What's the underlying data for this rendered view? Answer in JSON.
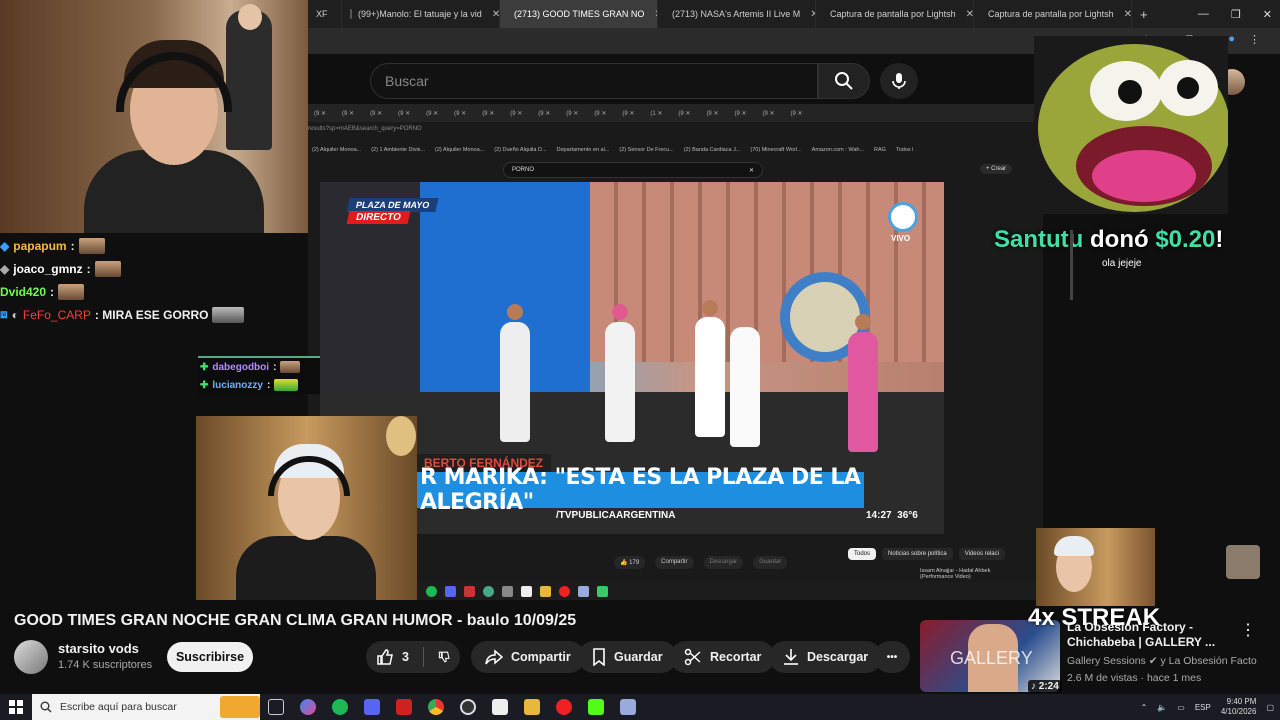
{
  "browser": {
    "tabs": [
      {
        "label": "XF",
        "active": false,
        "icon_color": "#444"
      },
      {
        "label": "(99+)Manolo: El tatuaje y la vid",
        "active": false,
        "icon_color": "#111"
      },
      {
        "label": "(2713) GOOD TIMES GRAN NO",
        "active": true,
        "icon_color": "#ff0033"
      },
      {
        "label": "(2713) NASA's Artemis II Live M",
        "active": false,
        "icon_color": "#ff0033"
      },
      {
        "label": "Captura de pantalla por Lightsh",
        "active": false,
        "icon_color": "#9a4ee0"
      },
      {
        "label": "Captura de pantalla por Lightsh",
        "active": false,
        "icon_color": "#9a4ee0"
      }
    ],
    "new_tab": "+"
  },
  "youtube": {
    "search_placeholder": "Buscar",
    "video_title": "GOOD TIMES GRAN NOCHE GRAN CLIMA GRAN HUMOR - baulo 10/09/25",
    "channel_name": "starsito vods",
    "subscribers": "1.74 K suscriptores",
    "subscribe_label": "Suscribirse",
    "like_count": "3",
    "share_label": "Compartir",
    "save_label": "Guardar",
    "clip_label": "Recortar",
    "download_label": "Descargar",
    "more_label": "•••",
    "recommended": {
      "title": "La Obsesión Factory - Chichabeba | GALLERY ...",
      "channel": "Gallery Sessions",
      "channel_extra": "y La Obsesión Facto...",
      "meta": "2.6 M de vistas · hace 1 mes",
      "duration": "2:24",
      "thumb_text": "GALLERY"
    }
  },
  "nested": {
    "url": "results?sp=mAEB&search_query=PORNO",
    "search_value": "PORNO",
    "create_label": "+ Crear",
    "bookmarks": [
      "(2) Alquiler Monoa...",
      "(2) 1 Ambiente Divis...",
      "(2) Alquiler Monoa...",
      "(2) Dueño Alquila D...",
      "Departamento en al...",
      "(2) Sensor De Frecu...",
      "(2) Banda Cardiaca J...",
      "(70) Minecraft Worl...",
      "Amazon.com : Wah...",
      "RAG",
      "Todos l"
    ],
    "like_count": "179",
    "actions": [
      "Compartir",
      "Descargar",
      "Guardar"
    ],
    "chips": [
      "Todos",
      "Noticias sobre política",
      "Videos relaci"
    ],
    "rec_title": "Issam Alnajjar - Hadal Ahbek (Performance Video)",
    "video": {
      "plaza_label": "PLAZA DE MAYO",
      "directo_label": "DIRECTO",
      "vivo_label": "VIVO",
      "chyron_name": "BERTO FERNÁNDEZ",
      "chyron_main": "R MARIKA: \"ESTA ES LA PLAZA DE LA ALEGRÍA\"",
      "chyron_handle": "/TVPUBLICAARGENTINA",
      "chyron_time": "14:27",
      "chyron_temp": "36°6"
    }
  },
  "chat": {
    "messages": [
      {
        "user": "papapum",
        "text": ":",
        "color": "#6fb0ff"
      },
      {
        "user": "joaco_gmnz",
        "text": ":",
        "color": "#ffffff"
      },
      {
        "user": "Dvid420",
        "text": ":",
        "color": "#6aff4a"
      },
      {
        "user": "FeFo_CARP",
        "text": ": MIRA ESE GORRO",
        "color": "#ff3b3b"
      }
    ],
    "small_chat": [
      {
        "user": "dabegodboi",
        "text": ":",
        "color": "#b08cff"
      },
      {
        "user": "lucianozzy",
        "text": ":",
        "color": "#6fb0ff"
      }
    ]
  },
  "overlay": {
    "donation_user": "Santutu",
    "donation_verb": "donó",
    "donation_amount": "$0.20",
    "donation_message": "ola jejeje",
    "streak": "4x STREAK"
  },
  "taskbar": {
    "search_placeholder": "Escribe aquí para buscar",
    "time": "9:40 PM",
    "date": "4/10/2026",
    "lang": "ESP"
  }
}
